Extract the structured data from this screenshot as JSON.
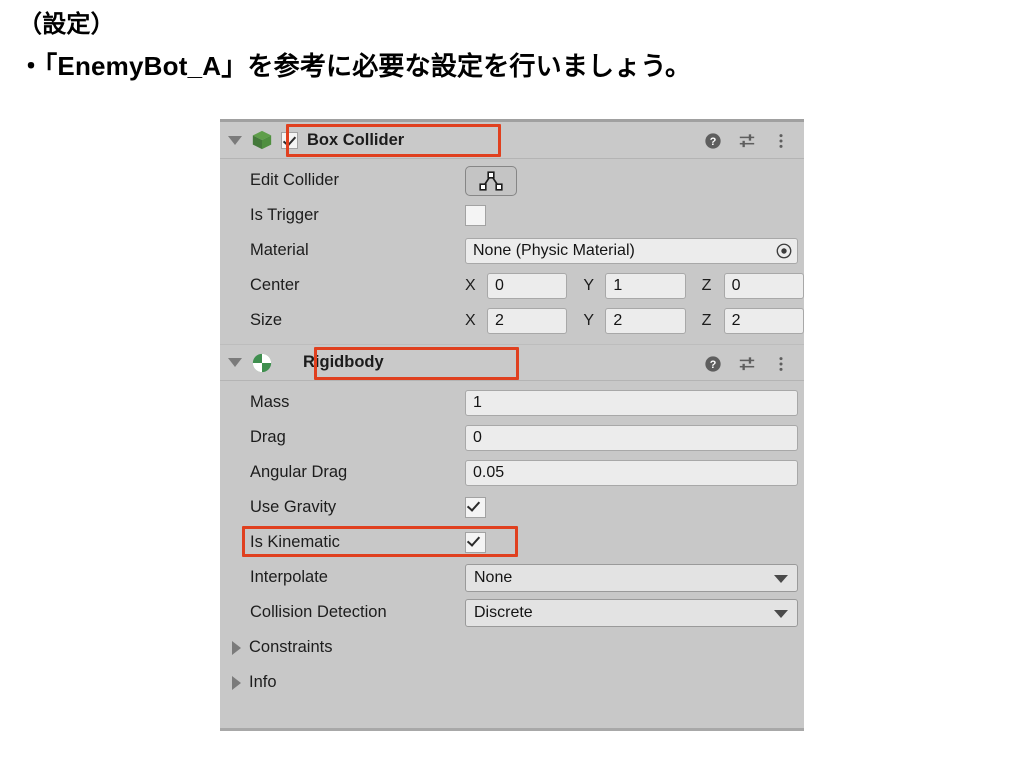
{
  "slide": {
    "heading_1": "（設定）",
    "heading_2": "・「EnemyBot_A」を参考に必要な設定を行いましょう。"
  },
  "colors": {
    "annotation_red": "#e0401f",
    "panel_bg": "#c8c8c8",
    "field_bg": "#ececec",
    "collider_icon_green": "#4f8f3f",
    "rigidbody_icon_green": "#3f8f4f"
  },
  "inspector": {
    "components": [
      {
        "name": "box-collider",
        "title": "Box Collider",
        "enabled_checkbox": true,
        "foldout_expanded": true,
        "highlighted": true,
        "header_icons": [
          "help-icon",
          "preset-icon",
          "more-menu-icon"
        ],
        "rows": [
          {
            "label": "Edit Collider",
            "type": "button",
            "icon": "edit-collider-icon"
          },
          {
            "label": "Is Trigger",
            "type": "checkbox",
            "checked": false
          },
          {
            "label": "Material",
            "type": "object-field",
            "value": "None (Physic Material)",
            "picker": "object-picker-icon"
          },
          {
            "label": "Center",
            "type": "vector3",
            "x": "0",
            "y": "1",
            "z": "0"
          },
          {
            "label": "Size",
            "type": "vector3",
            "x": "2",
            "y": "2",
            "z": "2"
          }
        ]
      },
      {
        "name": "rigidbody",
        "title": "Rigidbody",
        "enabled_checkbox": null,
        "foldout_expanded": true,
        "highlighted": true,
        "header_icons": [
          "help-icon",
          "preset-icon",
          "more-menu-icon"
        ],
        "rows": [
          {
            "label": "Mass",
            "type": "text-field",
            "value": "1"
          },
          {
            "label": "Drag",
            "type": "text-field",
            "value": "0"
          },
          {
            "label": "Angular Drag",
            "type": "text-field",
            "value": "0.05"
          },
          {
            "label": "Use Gravity",
            "type": "checkbox",
            "checked": true
          },
          {
            "label": "Is Kinematic",
            "type": "checkbox",
            "checked": true,
            "highlighted": true
          },
          {
            "label": "Interpolate",
            "type": "dropdown",
            "value": "None"
          },
          {
            "label": "Collision Detection",
            "type": "dropdown",
            "value": "Discrete"
          },
          {
            "label": "Constraints",
            "type": "foldout",
            "expanded": false
          },
          {
            "label": "Info",
            "type": "foldout",
            "expanded": false
          }
        ]
      }
    ],
    "axis_labels": {
      "x": "X",
      "y": "Y",
      "z": "Z"
    }
  }
}
